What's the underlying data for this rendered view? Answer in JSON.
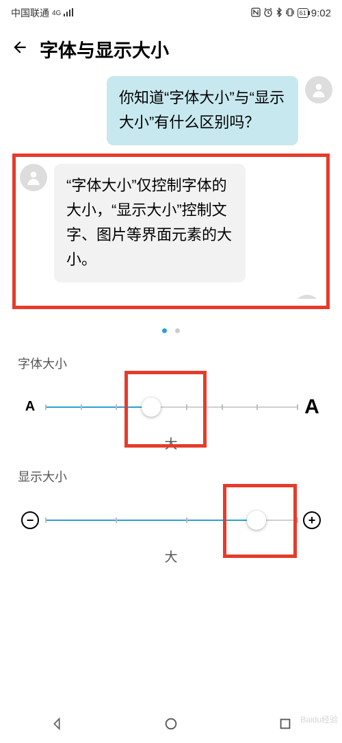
{
  "status": {
    "carrier": "中国联通",
    "net": "4G",
    "battery": "61",
    "time": "9:02"
  },
  "header": {
    "title": "字体与显示大小"
  },
  "preview": {
    "msg1": "你知道“字体大小”与“显示大小”有什么区别吗？",
    "msg2": "“字体大小”仅控制字体的大小，“显示大小”控制文字、图片等界面元素的大小。"
  },
  "font_size": {
    "label": "字体大小",
    "value_label": "大",
    "small_icon": "A",
    "big_icon": "A",
    "percent": 42
  },
  "display_size": {
    "label": "显示大小",
    "value_label": "大",
    "percent": 84
  },
  "watermark": "Baidu经验"
}
